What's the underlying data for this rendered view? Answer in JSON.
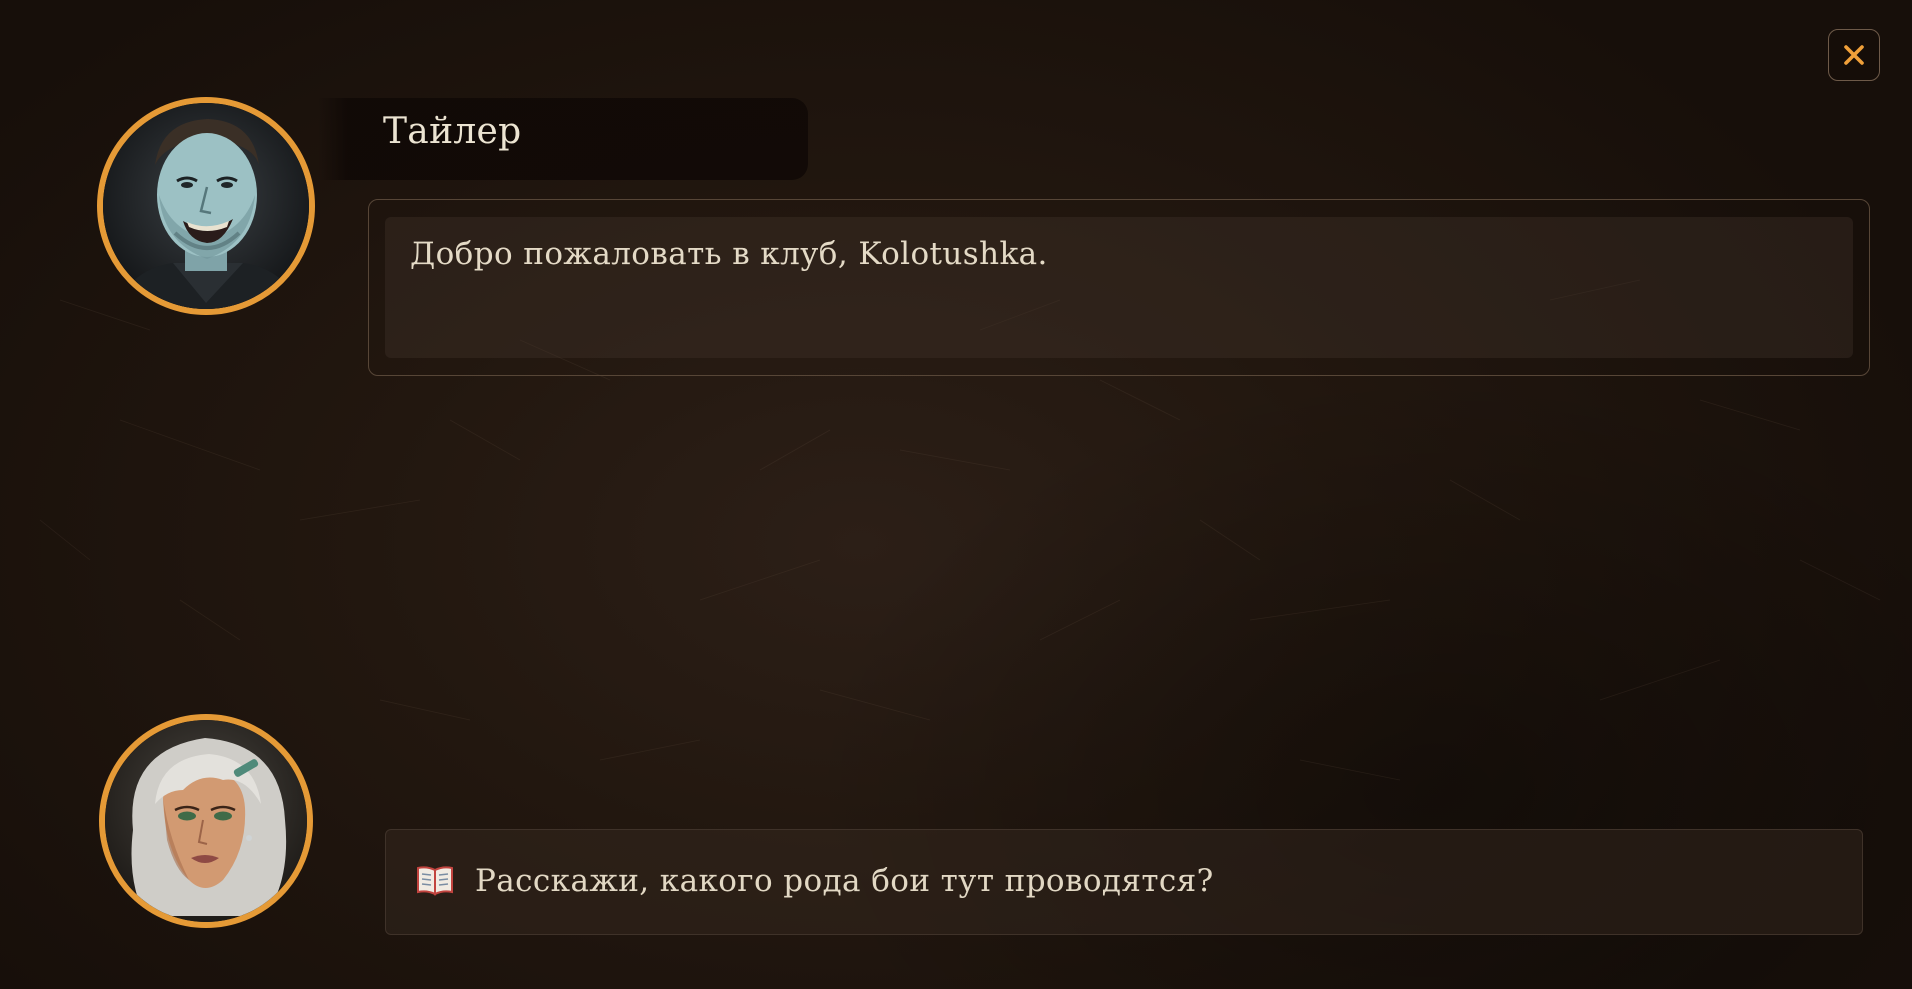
{
  "colors": {
    "accent": "#e59a36",
    "background": "#22170f",
    "text": "#e4dac6",
    "frame": "#574637"
  },
  "header": {
    "close_icon": "close-icon"
  },
  "speaker": {
    "name": "Тайлер",
    "portrait": "tyler-portrait"
  },
  "dialogue": {
    "text": "Добро пожаловать в клуб, Kolotushka."
  },
  "player": {
    "portrait": "player-portrait"
  },
  "reply_options": [
    {
      "icon": "book-icon",
      "label": "Расскажи, какого рода бои тут проводятся?"
    }
  ]
}
